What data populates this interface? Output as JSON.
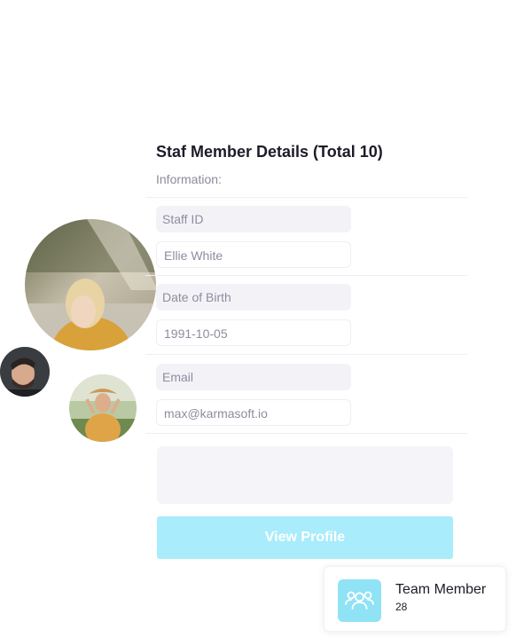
{
  "details": {
    "title": "Staf Member Details (Total 10)",
    "subtitle": "Information:"
  },
  "fields": [
    {
      "label": "Staff ID",
      "value": "Ellie White"
    },
    {
      "label": "Date of Birth",
      "value": "1991-10-05"
    },
    {
      "label": "Email",
      "value": "max@karmasoft.io"
    }
  ],
  "actions": {
    "view_profile_label": "View Profile"
  },
  "team_card": {
    "label": "Team Member",
    "count": "28",
    "icon": "team-icon"
  },
  "colors": {
    "accent": "#a9ecfb",
    "team_icon_bg": "#8fe3f5",
    "field_bg": "#f3f3f7"
  }
}
